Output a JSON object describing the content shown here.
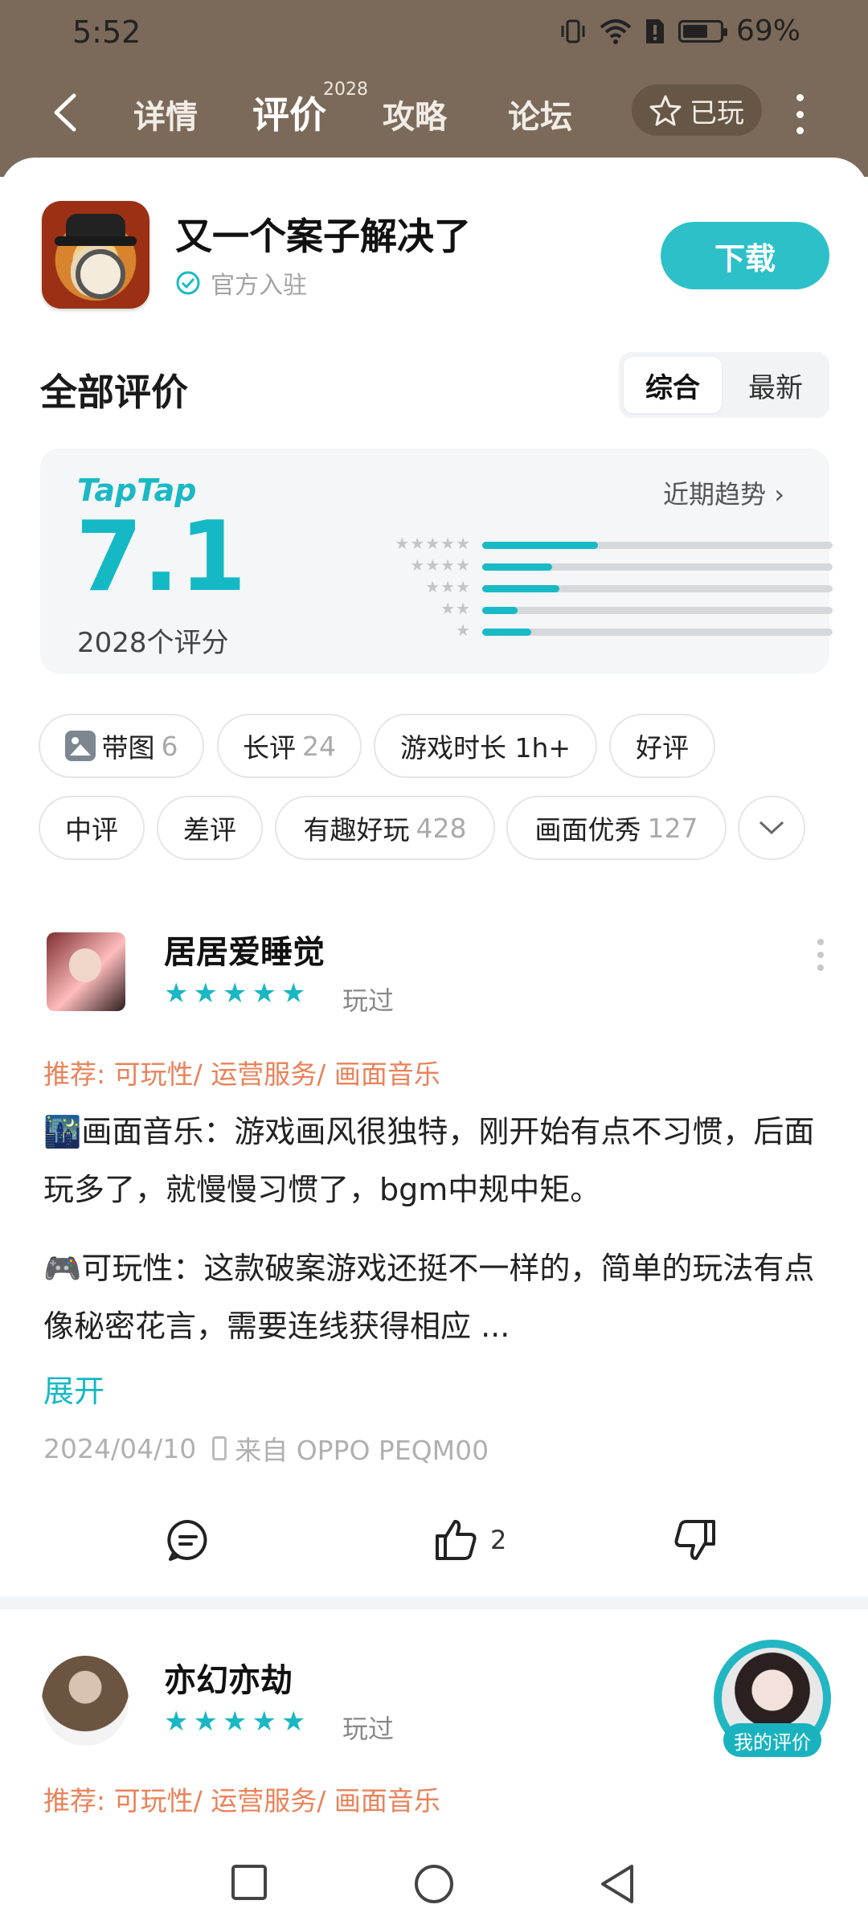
{
  "status_bar": {
    "time": "5:52",
    "battery": "69%",
    "battery_level": 0.69
  },
  "nav": {
    "tabs": [
      "详情",
      "评价",
      "攻略",
      "论坛"
    ],
    "active_tab": "评价",
    "review_tab_count": "2028",
    "played_button": "已玩"
  },
  "app": {
    "title": "又一个案子解决了",
    "official": "官方入驻",
    "download": "下载"
  },
  "reviews_section": {
    "title": "全部评价",
    "sort_options": [
      "综合",
      "最新"
    ],
    "active_sort": "综合"
  },
  "rating": {
    "brand": "TapTap",
    "score": "7.1",
    "count_text": "2028个评分",
    "trend": "近期趋势",
    "distribution": [
      {
        "stars": 5,
        "fraction": 0.33
      },
      {
        "stars": 4,
        "fraction": 0.2
      },
      {
        "stars": 3,
        "fraction": 0.22
      },
      {
        "stars": 2,
        "fraction": 0.1
      },
      {
        "stars": 1,
        "fraction": 0.14
      }
    ]
  },
  "filters": [
    {
      "label": "带图",
      "count": "6",
      "icon": "image-icon"
    },
    {
      "label": "长评",
      "count": "24"
    },
    {
      "label": "游戏时长 1h+",
      "count": ""
    },
    {
      "label": "好评",
      "count": ""
    },
    {
      "label": "中评",
      "count": ""
    },
    {
      "label": "差评",
      "count": ""
    },
    {
      "label": "有趣好玩",
      "count": "428"
    },
    {
      "label": "画面优秀",
      "count": "127"
    }
  ],
  "review1": {
    "user": "居居爱睡觉",
    "stars": 5,
    "played": "玩过",
    "recommend": "推荐: 可玩性/ 运营服务/ 画面音乐",
    "para1": "🌃画面音乐：游戏画风很独特，刚开始有点不习惯，后面玩多了，就慢慢习惯了，bgm中规中矩。",
    "para2": "🎮可玩性：这款破案游戏还挺不一样的，简单的玩法有点像秘密花言，需要连线获得相应 ...",
    "expand": "展开",
    "date": "2024/04/10",
    "device": "来自 OPPO PEQM00",
    "likes": "2"
  },
  "review2": {
    "user": "亦幻亦劫",
    "stars": 5,
    "played": "玩过",
    "recommend": "推荐: 可玩性/ 运营服务/ 画面音乐"
  },
  "my_review": "我的评价",
  "colors": {
    "accent": "#19bac6",
    "header": "#7b6a5a",
    "recommend": "#e9825a"
  }
}
